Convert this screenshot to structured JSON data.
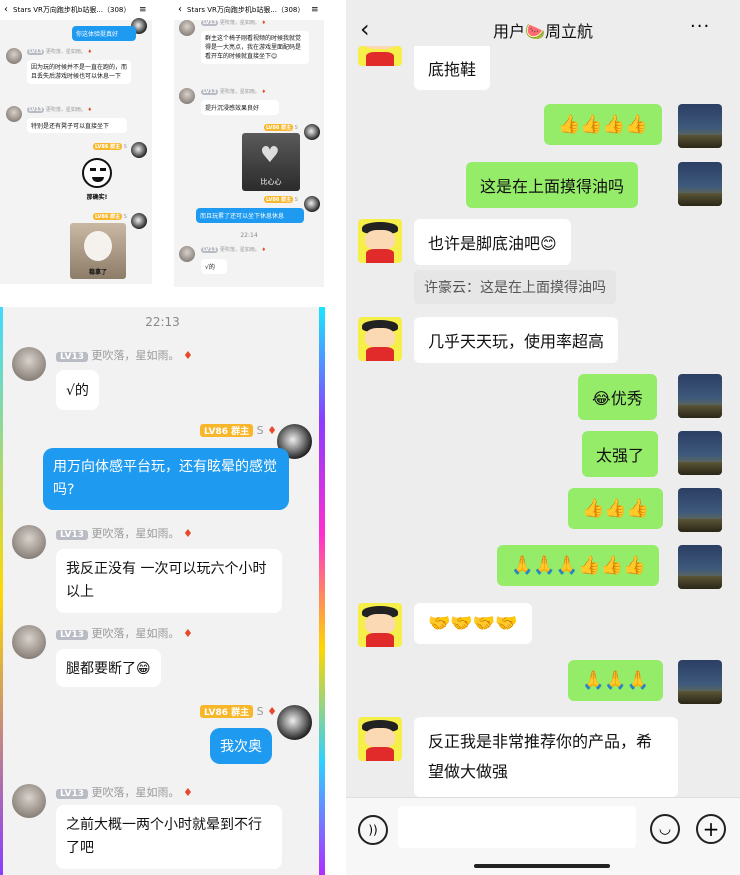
{
  "p1": {
    "title": "Stars VR万向跑步机b站狠...（308）",
    "menu_icon": "≡",
    "msg_top": "你这体验挺真好",
    "nick": "更吹落，星如雨。",
    "lv": "LV13",
    "msg_a": "因为玩的时候并不是一直在跑的，而且丢失后游戏时候也可以休息一下",
    "msg_b": "特别是还有凳子可以直接坐下",
    "lv86": "LV86 群主",
    "owner_s": "S",
    "sticker1_caption": "那确实!",
    "sticker2_caption": "稳拿了"
  },
  "p2": {
    "title": "Stars VR万向跑步机b站狠...（308）",
    "menu_icon": "≡",
    "nick": "更吹落，星如雨。",
    "lv": "LV13",
    "msg_a": "群主这个椅子刚看视频的时候我就觉得是一大亮点，我在游戏里面配码是看开车的时候就直接坐下😊",
    "msg_b": "提升沉浸感效果良好",
    "lv86": "LV86 群主",
    "owner_s": "S",
    "sticker_caption": "比心心",
    "msg_c": "而且玩累了还可以坐下休息休息",
    "time": "22:14",
    "msg_d": "√的"
  },
  "p3": {
    "time": "22:13",
    "lv": "LV13",
    "nick": "更吹落，星如雨。",
    "lv86": "LV86 群主",
    "owner_s": "S",
    "msgs": [
      "√的",
      "用万向体感平台玩，还有眩晕的感觉吗?",
      "我反正没有 一次可以玩六个小时以上",
      "腿都要断了😁",
      "我次奥",
      "之前大概一两个小时就晕到不行了吧"
    ]
  },
  "wechat": {
    "back_icon": "chevron-left",
    "title": "用户🍉周立航",
    "more": "···",
    "msgs": [
      "底拖鞋",
      "👍👍👍👍",
      "这是在上面摸得油吗",
      "也许是脚底油吧😊",
      "许豪云：这是在上面摸得油吗",
      "几乎天天玩，使用率超高",
      "😂优秀",
      "太强了",
      "👍👍👍",
      "🙏🙏🙏👍👍👍",
      "🤝🤝🤝🤝",
      "🙏🙏🙏",
      "反正我是非常推荐你的产品，希望做大做强"
    ],
    "input_placeholder": "",
    "voice_icon": "voice-icon",
    "emoji_icon": "smile-icon",
    "plus_icon": "plus-icon"
  }
}
